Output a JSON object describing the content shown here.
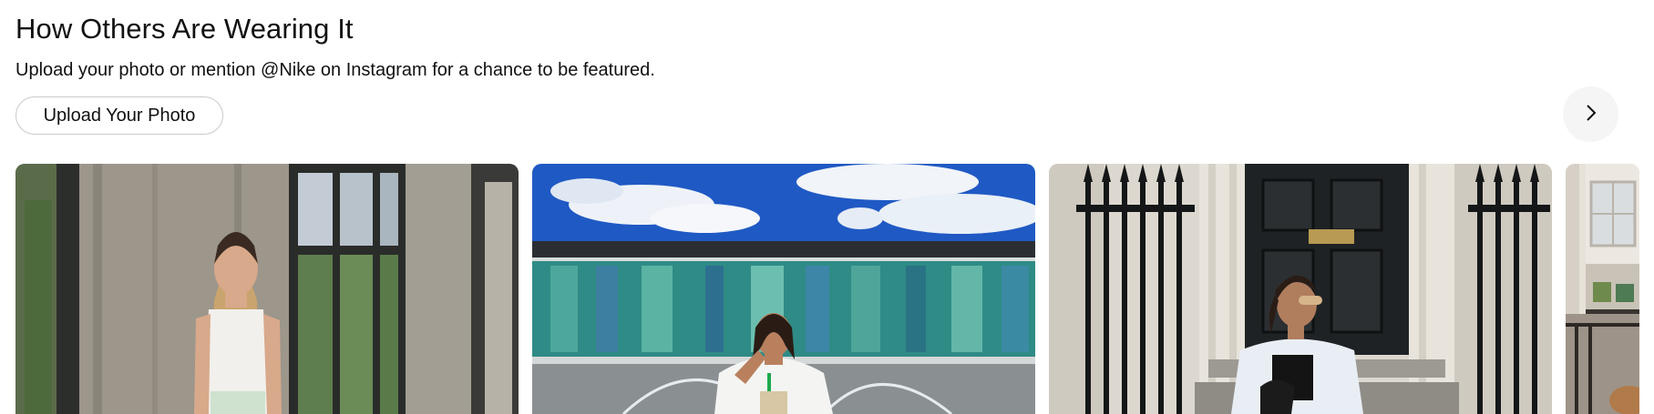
{
  "section": {
    "title": "How Others Are Wearing It",
    "subtitle": "Upload your photo or mention @Nike on Instagram for a chance to be featured.",
    "upload_label": "Upload Your Photo",
    "next_icon": "chevron-right-icon"
  },
  "gallery": {
    "photos": [
      {
        "name": "ugc-photo-1",
        "scene": "woman in white tank top by concrete pillar and windows"
      },
      {
        "name": "ugc-photo-2",
        "scene": "woman by fountain in front of glass building under blue sky"
      },
      {
        "name": "ugc-photo-3",
        "scene": "woman seated on steps before black door and iron gates"
      },
      {
        "name": "ugc-photo-4",
        "scene": "partially visible photo of building facade"
      }
    ]
  },
  "colors": {
    "text": "#111111",
    "border": "#cacacb",
    "next_bg": "#f5f5f5",
    "sky": "#1f59c4"
  }
}
